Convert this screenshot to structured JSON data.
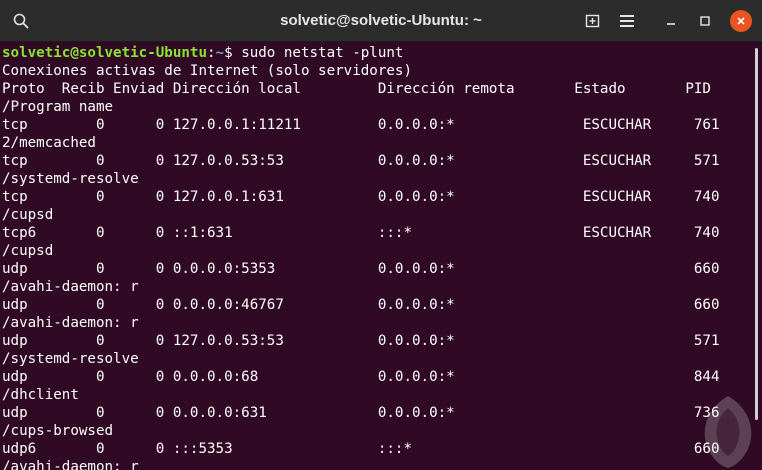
{
  "window": {
    "title": "solvetic@solvetic-Ubuntu: ~",
    "icons": [
      "search-icon",
      "new-tab-icon",
      "hamburger-menu-icon",
      "minimize-icon",
      "maximize-icon",
      "close-icon"
    ],
    "colors": {
      "terminal_bg": "#300a24",
      "titlebar_bg": "#2c2c2c",
      "close_button": "#e95420",
      "prompt_user": "#8ae234",
      "prompt_path": "#729fcf"
    }
  },
  "terminal": {
    "prompt": {
      "user_host": "solvetic@solvetic-Ubuntu",
      "colon": ":",
      "path": "~",
      "symbol": "$ ",
      "command": "sudo netstat -plunt"
    },
    "lines": [
      "Conexiones activas de Internet (solo servidores)",
      "Proto  Recib Enviad Dirección local         Dirección remota       Estado       PID",
      "/Program name",
      "tcp        0      0 127.0.0.1:11211         0.0.0.0:*               ESCUCHAR     761",
      "2/memcached",
      "tcp        0      0 127.0.0.53:53           0.0.0.0:*               ESCUCHAR     571",
      "/systemd-resolve",
      "tcp        0      0 127.0.0.1:631           0.0.0.0:*               ESCUCHAR     740",
      "/cupsd",
      "tcp6       0      0 ::1:631                 :::*                    ESCUCHAR     740",
      "/cupsd",
      "udp        0      0 0.0.0.0:5353            0.0.0.0:*                            660",
      "/avahi-daemon: r",
      "udp        0      0 0.0.0.0:46767           0.0.0.0:*                            660",
      "/avahi-daemon: r",
      "udp        0      0 127.0.0.53:53           0.0.0.0:*                            571",
      "/systemd-resolve",
      "udp        0      0 0.0.0.0:68              0.0.0.0:*                            844",
      "/dhclient",
      "udp        0      0 0.0.0.0:631             0.0.0.0:*                            736",
      "/cups-browsed",
      "udp6       0      0 :::5353                 :::*                                 660",
      "/avahi-daemon: r"
    ]
  }
}
